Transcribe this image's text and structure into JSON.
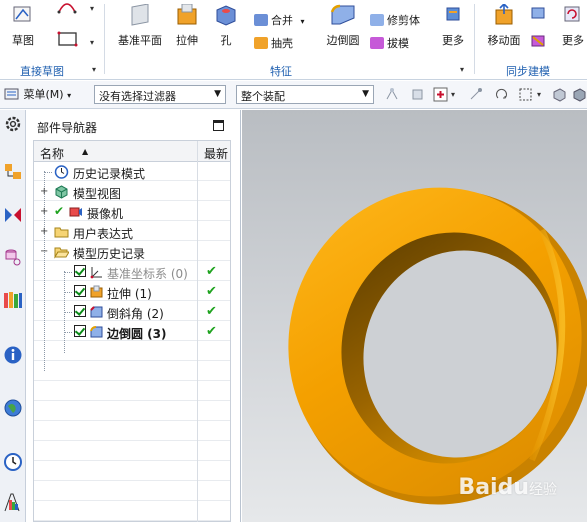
{
  "ribbon": {
    "groups": [
      {
        "label": "直接草图"
      },
      {
        "label": "特征"
      },
      {
        "label": "同步建模"
      }
    ],
    "buttons": {
      "sketch": "草图",
      "datum_plane": "基准平面",
      "extrude": "拉伸",
      "hole": "孔",
      "merge": "合并",
      "shell": "抽壳",
      "edge_blend": "边倒圆",
      "trim": "修剪体",
      "draft": "拔模",
      "more1": "更多",
      "move_face": "移动面",
      "more2": "更多"
    }
  },
  "toolbar": {
    "menu_label": "菜单(M)",
    "filter_value": "没有选择过滤器",
    "assembly_value": "整个装配"
  },
  "navigator": {
    "title": "部件导航器",
    "columns": {
      "name": "名称",
      "latest": "最新"
    },
    "rows": [
      {
        "label": "历史记录模式"
      },
      {
        "label": "模型视图"
      },
      {
        "label": "摄像机"
      },
      {
        "label": "用户表达式"
      },
      {
        "label": "模型历史记录"
      },
      {
        "label": "基准坐标系 (0)",
        "latest": "✔"
      },
      {
        "label": "拉伸 (1)",
        "latest": "✔"
      },
      {
        "label": "倒斜角 (2)",
        "latest": "✔"
      },
      {
        "label": "边倒圆 (3)",
        "latest": "✔"
      }
    ]
  },
  "colors": {
    "accent": "#2060b0",
    "model": "#f4a400",
    "check_green": "#1fa31f"
  },
  "watermark": {
    "brand": "Baidu",
    "sub": "经验"
  }
}
